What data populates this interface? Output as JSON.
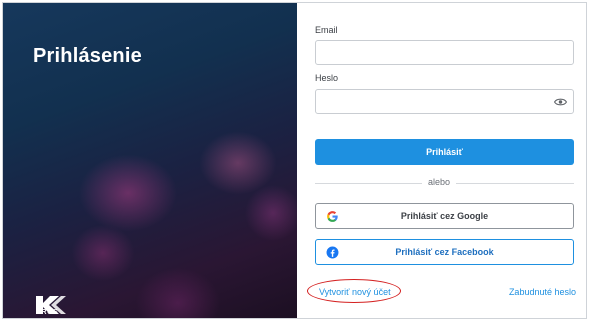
{
  "left": {
    "title": "Prihlásenie",
    "logo_text": "KROS"
  },
  "form": {
    "email_label": "Email",
    "email_value": "",
    "password_label": "Heslo",
    "password_value": "",
    "login_button": "Prihlásiť",
    "divider_text": "alebo",
    "google_button": "Prihlásiť cez Google",
    "facebook_button": "Prihlásiť cez Facebook",
    "create_account_link": "Vytvoriť nový účet",
    "forgot_password_link": "Zabudnuté heslo"
  },
  "colors": {
    "primary": "#1e90e0",
    "annotation_red": "#d42020"
  },
  "icons": {
    "password_toggle": "eye-icon",
    "google": "google-icon",
    "facebook": "facebook-icon"
  }
}
